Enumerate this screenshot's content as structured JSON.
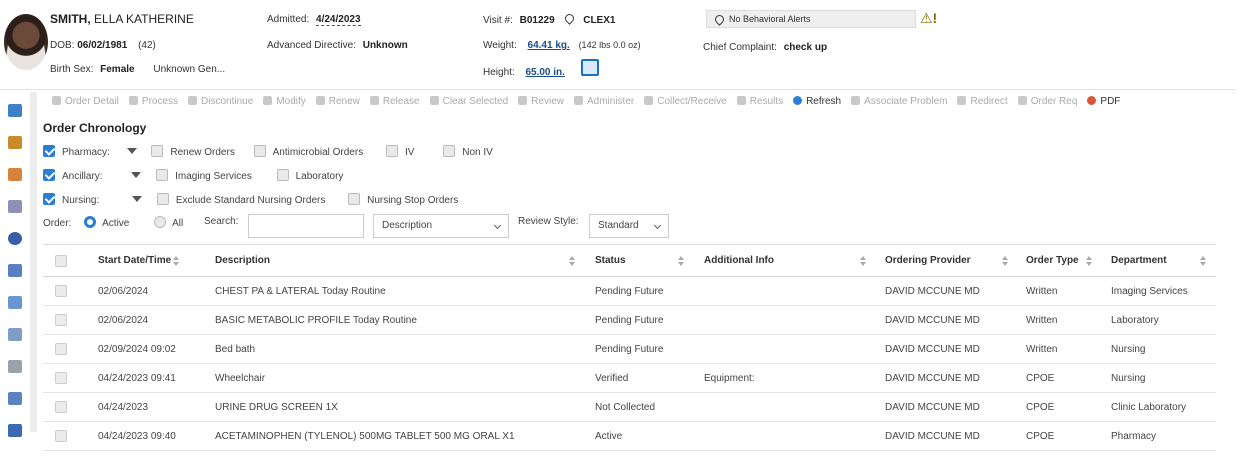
{
  "patient": {
    "last_name": "SMITH,",
    "first_name": "ELLA KATHERINE",
    "dob_label": "DOB:",
    "dob": "06/02/1981",
    "age": "(42)",
    "birth_sex_label": "Birth Sex:",
    "birth_sex": "Female",
    "gender": "Unknown Gen...",
    "admitted_label": "Admitted:",
    "admitted": "4/24/2023",
    "advanced_directive_label": "Advanced Directive:",
    "advanced_directive": "Unknown",
    "visit_label": "Visit #:",
    "visit": "B01229",
    "location": "CLEX1",
    "weight_label": "Weight:",
    "weight": "64.41 kg.",
    "weight_alt": "(142 lbs 0.0 oz)",
    "height_label": "Height:",
    "height": "65.00 in.",
    "behavioral_alert": "No Behavioral Alerts",
    "chief_complaint_label": "Chief Complaint:",
    "chief_complaint": "check up"
  },
  "toolbar": [
    {
      "label": "Order Detail",
      "icon": "order-detail-icon",
      "enabled": false
    },
    {
      "label": "Process",
      "icon": "process-icon",
      "enabled": false
    },
    {
      "label": "Discontinue",
      "icon": "discontinue-icon",
      "enabled": false
    },
    {
      "label": "Modify",
      "icon": "modify-icon",
      "enabled": false
    },
    {
      "label": "Renew",
      "icon": "renew-icon",
      "enabled": false
    },
    {
      "label": "Release",
      "icon": "release-icon",
      "enabled": false
    },
    {
      "label": "Clear Selected",
      "icon": "clear-icon",
      "enabled": false
    },
    {
      "label": "Review",
      "icon": "review-icon",
      "enabled": false
    },
    {
      "label": "Administer",
      "icon": "administer-icon",
      "enabled": false
    },
    {
      "label": "Collect/Receive",
      "icon": "collect-icon",
      "enabled": false
    },
    {
      "label": "Results",
      "icon": "results-icon",
      "enabled": false
    },
    {
      "label": "Refresh",
      "icon": "refresh-icon",
      "enabled": true
    },
    {
      "label": "Associate Problem",
      "icon": "associate-problem-icon",
      "enabled": false
    },
    {
      "label": "Redirect",
      "icon": "redirect-icon",
      "enabled": false
    },
    {
      "label": "Order Req",
      "icon": "order-req-icon",
      "enabled": false
    },
    {
      "label": "PDF",
      "icon": "pdf-icon",
      "enabled": true
    }
  ],
  "section_title": "Order Chronology",
  "filters": {
    "pharmacy": "Pharmacy:",
    "renew_orders": "Renew Orders",
    "antimicrobial_orders": "Antimicrobial Orders",
    "iv": "IV",
    "non_iv": "Non IV",
    "ancillary": "Ancillary:",
    "imaging_services": "Imaging Services",
    "laboratory": "Laboratory",
    "nursing": "Nursing:",
    "exclude_standard_nursing": "Exclude Standard Nursing Orders",
    "nursing_stop_orders": "Nursing Stop Orders",
    "order_label": "Order:",
    "active": "Active",
    "all": "All",
    "search_label": "Search:",
    "search_value": "",
    "search_field": "Description",
    "review_style_label": "Review Style:",
    "review_style": "Standard"
  },
  "table": {
    "columns": [
      "Start Date/Time",
      "Description",
      "Status",
      "Additional Info",
      "Ordering Provider",
      "Order Type",
      "Department"
    ],
    "rows": [
      [
        "02/06/2024",
        "CHEST PA & LATERAL Today Routine",
        "Pending Future",
        "",
        "DAVID MCCUNE MD",
        "Written",
        "Imaging Services"
      ],
      [
        "02/06/2024",
        "BASIC METABOLIC PROFILE Today Routine",
        "Pending Future",
        "",
        "DAVID MCCUNE MD",
        "Written",
        "Laboratory"
      ],
      [
        "02/09/2024 09:02",
        "Bed bath",
        "Pending Future",
        "",
        "DAVID MCCUNE MD",
        "Written",
        "Nursing"
      ],
      [
        "04/24/2023 09:41",
        "Wheelchair",
        "Verified",
        "Equipment:",
        "DAVID MCCUNE MD",
        "CPOE",
        "Nursing"
      ],
      [
        "04/24/2023",
        "URINE DRUG SCREEN 1X",
        "Not Collected",
        "",
        "DAVID MCCUNE MD",
        "CPOE",
        "Clinic Laboratory"
      ],
      [
        "04/24/2023 09:40",
        "ACETAMINOPHEN (TYLENOL) 500MG TABLET 500 MG ORAL X1",
        "Active",
        "",
        "DAVID MCCUNE MD",
        "CPOE",
        "Pharmacy"
      ]
    ]
  },
  "colors": {
    "accent": "#2a7fd4",
    "link": "#1a4f8a"
  }
}
